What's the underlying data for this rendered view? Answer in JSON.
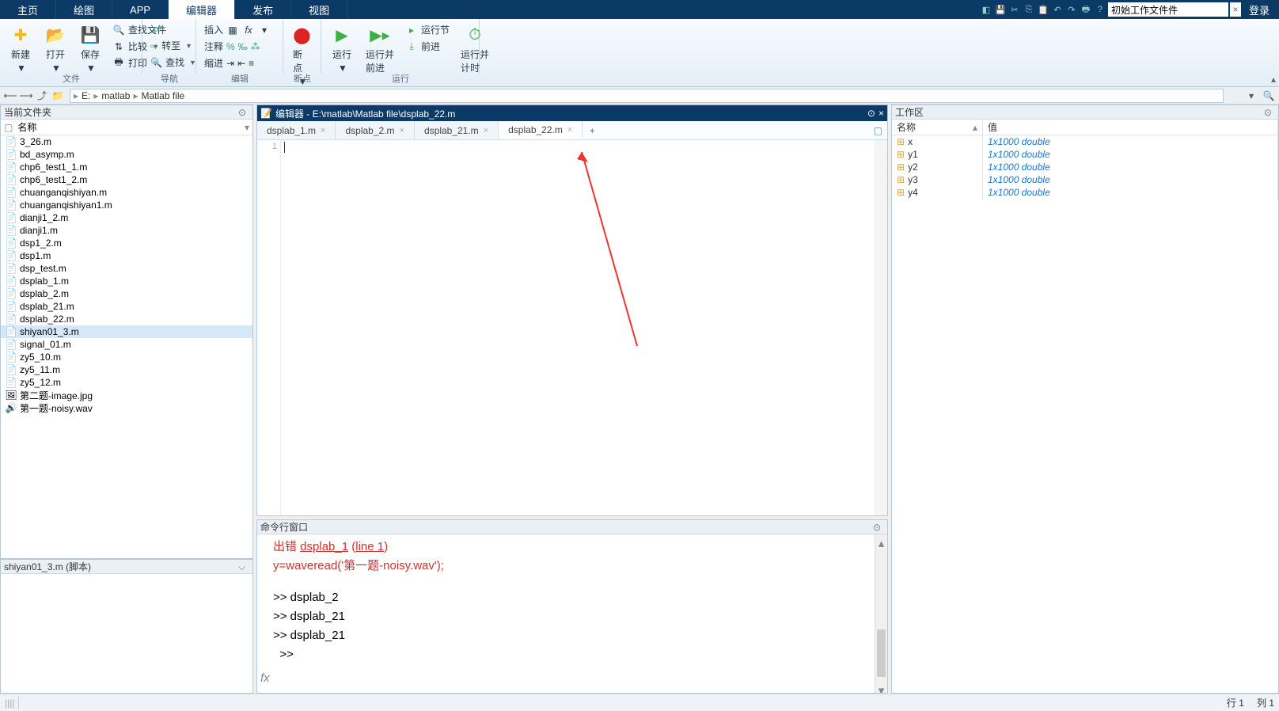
{
  "menu": {
    "tabs": [
      "主页",
      "绘图",
      "APP",
      "编辑器",
      "发布",
      "视图"
    ],
    "active": 3,
    "search_value": "初始工作文件件",
    "login": "登录"
  },
  "toolstrip": {
    "file": {
      "label": "文件",
      "new": "新建",
      "open": "打开",
      "save": "保存",
      "find": "查找文件",
      "compare": "比较",
      "print": "打印"
    },
    "nav": {
      "label": "导航",
      "goto": "转至",
      "find": "查找"
    },
    "edit": {
      "label": "编辑",
      "insert": "插入",
      "comment": "注释",
      "indent": "缩进"
    },
    "bp": {
      "label": "断点",
      "bp": "断点"
    },
    "run": {
      "label": "运行",
      "run": "运行",
      "run_advance": "运行并\n前进",
      "run_section": "运行节",
      "advance": "前进",
      "run_time": "运行并\n计时"
    }
  },
  "addr": {
    "drive": "E:",
    "segs": [
      "matlab",
      "Matlab file"
    ]
  },
  "current_folder": {
    "title": "当前文件夹",
    "name_col": "名称",
    "files": [
      {
        "n": "3_26.m",
        "t": "m"
      },
      {
        "n": "bd_asymp.m",
        "t": "m"
      },
      {
        "n": "chp6_test1_1.m",
        "t": "m"
      },
      {
        "n": "chp6_test1_2.m",
        "t": "m"
      },
      {
        "n": "chuanganqishiyan.m",
        "t": "m"
      },
      {
        "n": "chuanganqishiyan1.m",
        "t": "m"
      },
      {
        "n": "dianji1_2.m",
        "t": "m"
      },
      {
        "n": "dianji1.m",
        "t": "m"
      },
      {
        "n": "dsp1_2.m",
        "t": "m"
      },
      {
        "n": "dsp1.m",
        "t": "m"
      },
      {
        "n": "dsp_test.m",
        "t": "m"
      },
      {
        "n": "dsplab_1.m",
        "t": "m"
      },
      {
        "n": "dsplab_2.m",
        "t": "m"
      },
      {
        "n": "dsplab_21.m",
        "t": "m"
      },
      {
        "n": "dsplab_22.m",
        "t": "m"
      },
      {
        "n": "shiyan01_3.m",
        "t": "m",
        "sel": true
      },
      {
        "n": "signal_01.m",
        "t": "m"
      },
      {
        "n": "zy5_10.m",
        "t": "m"
      },
      {
        "n": "zy5_11.m",
        "t": "m"
      },
      {
        "n": "zy5_12.m",
        "t": "m"
      },
      {
        "n": "第二题-image.jpg",
        "t": "img"
      },
      {
        "n": "第一题-noisy.wav",
        "t": "wav"
      }
    ]
  },
  "script_preview": {
    "title": "shiyan01_3.m  (脚本)"
  },
  "editor": {
    "title_prefix": "编辑器 - ",
    "path": "E:\\matlab\\Matlab file\\dsplab_22.m",
    "tabs": [
      {
        "n": "dsplab_1.m"
      },
      {
        "n": "dsplab_2.m"
      },
      {
        "n": "dsplab_21.m"
      },
      {
        "n": "dsplab_22.m",
        "active": true
      }
    ],
    "line_no": "1"
  },
  "cmd": {
    "title": "命令行窗口",
    "err_label": "出错 ",
    "err_file": "dsplab_1",
    "err_line_open": " (",
    "err_line": "line 1",
    "err_line_close": ")",
    "err_code": "y=waveread('第一题-noisy.wav');",
    "h1": ">> dsplab_2",
    "h2": ">> dsplab_21",
    "h3": ">> dsplab_21",
    "prompt": ">> ",
    "fx": "fx"
  },
  "workspace": {
    "title": "工作区",
    "name_col": "名称",
    "val_col": "值",
    "vars": [
      {
        "n": "x",
        "v": "1x1000 double"
      },
      {
        "n": "y1",
        "v": "1x1000 double"
      },
      {
        "n": "y2",
        "v": "1x1000 double"
      },
      {
        "n": "y3",
        "v": "1x1000 double"
      },
      {
        "n": "y4",
        "v": "1x1000 double"
      }
    ]
  },
  "status": {
    "row_label": "行",
    "row": "1",
    "col_label": "列",
    "col": "1"
  }
}
